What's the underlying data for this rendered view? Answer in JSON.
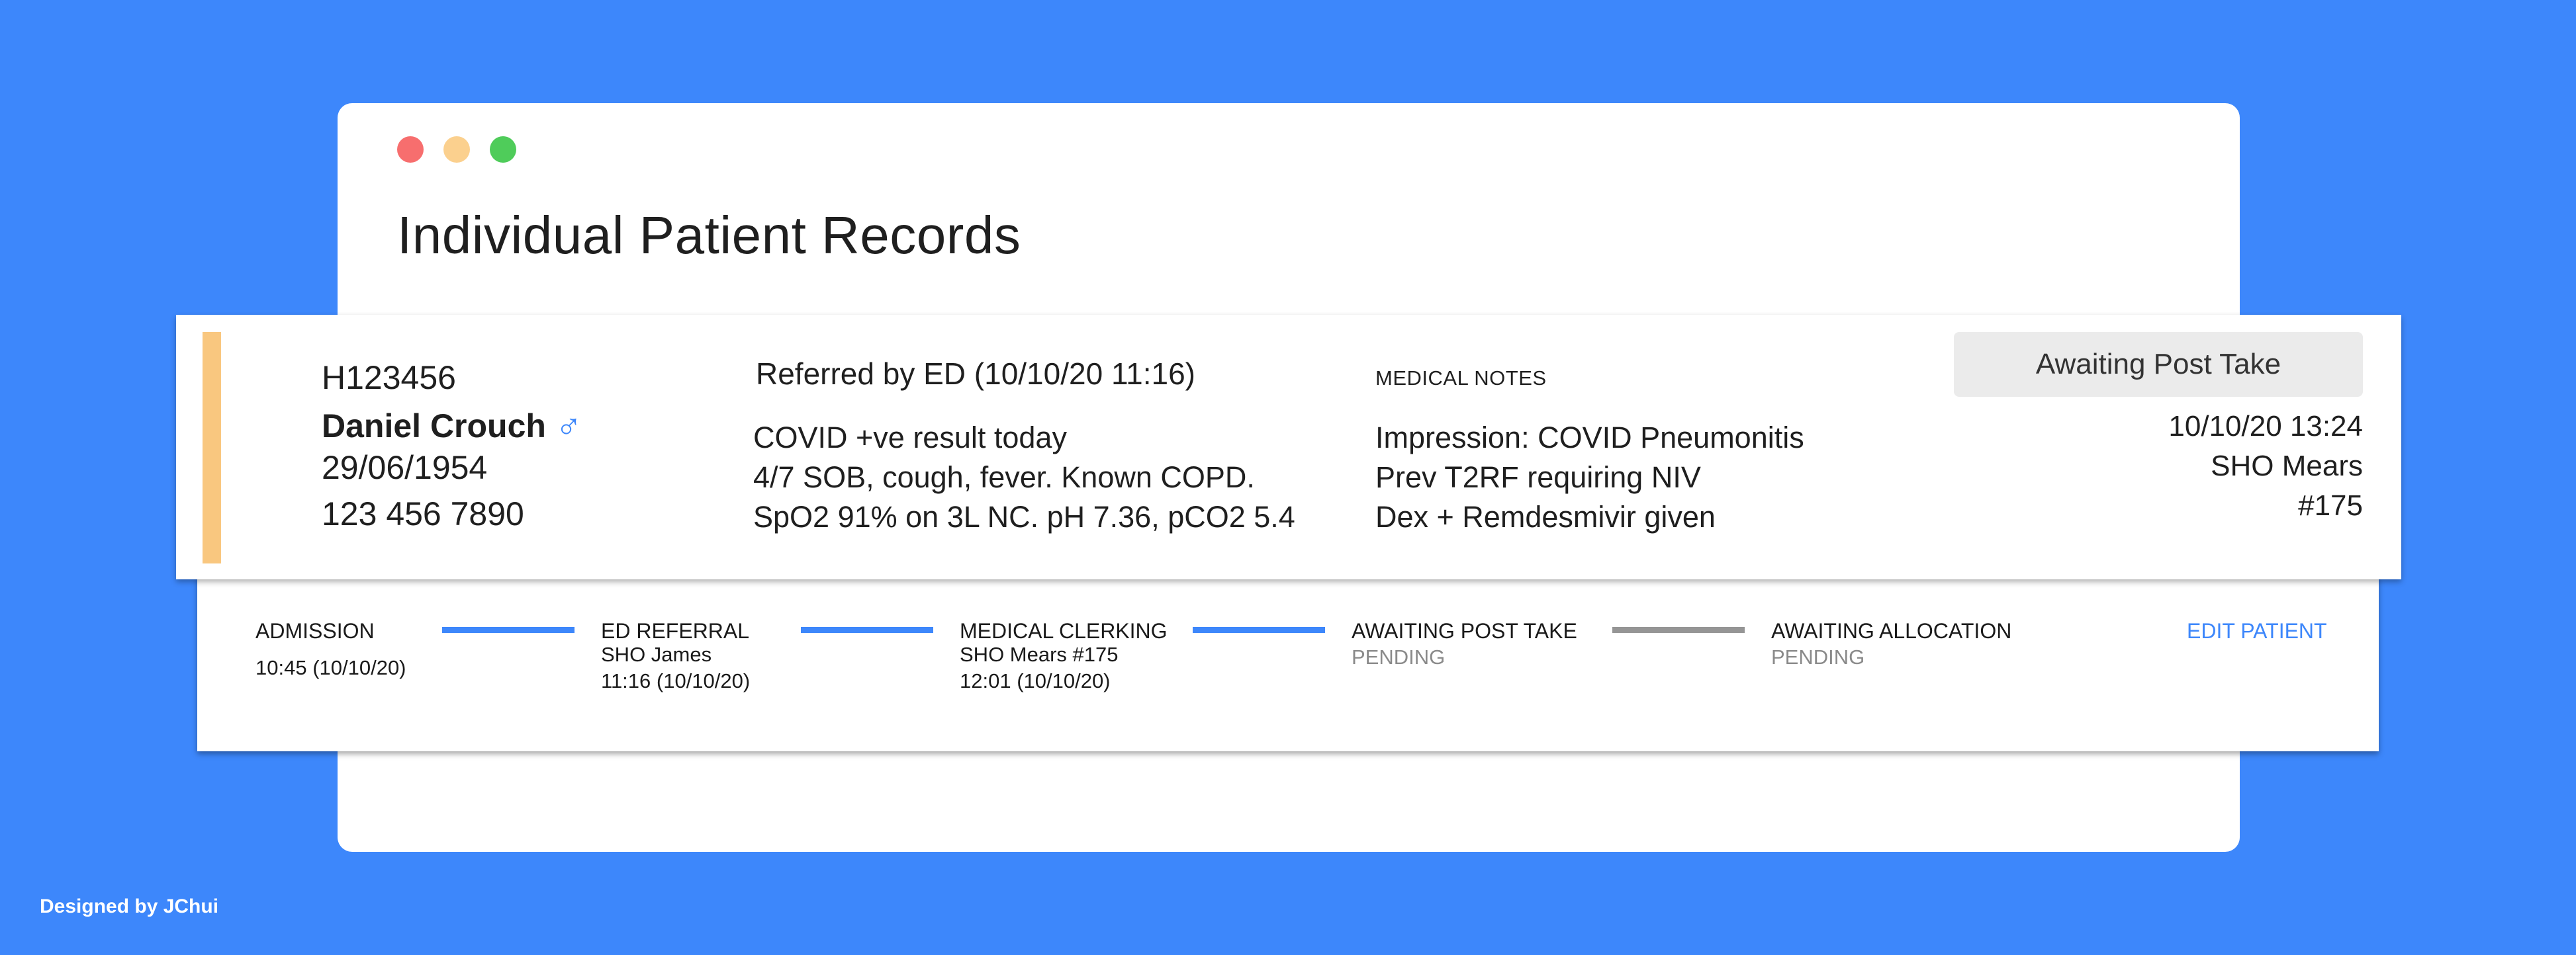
{
  "window": {
    "title": "Individual Patient Records"
  },
  "patient": {
    "hospital_number": "H123456",
    "name": "Daniel Crouch",
    "gender_icon": "male-icon",
    "dob": "29/06/1954",
    "phone": "123 456 7890",
    "accent_color": "#f9c77f"
  },
  "referral": {
    "heading": "Referred by ED (10/10/20 11:16)",
    "lines": [
      "COVID +ve result today",
      "4/7 SOB, cough, fever. Known COPD.",
      "SpO2 91% on 3L NC. pH 7.36, pCO2 5.4"
    ]
  },
  "medical_notes": {
    "label": "MEDICAL NOTES",
    "lines": [
      "Impression: COVID Pneumonitis",
      "Prev T2RF requiring NIV",
      "Dex + Remdesmivir given"
    ]
  },
  "status": {
    "badge": "Awaiting Post Take",
    "datetime": "10/10/20 13:24",
    "doctor": "SHO Mears",
    "number": "#175"
  },
  "timeline": {
    "stages": [
      {
        "title": "ADMISSION",
        "lines": [
          "10:45 (10/10/20)"
        ]
      },
      {
        "title": "ED REFERRAL",
        "lines": [
          "SHO James",
          "11:16 (10/10/20)"
        ]
      },
      {
        "title": "MEDICAL CLERKING",
        "lines": [
          "SHO Mears #175",
          "12:01 (10/10/20)"
        ]
      },
      {
        "title": "AWAITING POST TAKE",
        "lines": [
          "PENDING"
        ]
      },
      {
        "title": "AWAITING ALLOCATION",
        "lines": [
          "PENDING"
        ]
      }
    ],
    "connectors": [
      {
        "status": "complete",
        "color": "#3d87fb"
      },
      {
        "status": "complete",
        "color": "#3d87fb"
      },
      {
        "status": "complete",
        "color": "#3d87fb"
      },
      {
        "status": "pending",
        "color": "#959595"
      }
    ],
    "edit_label": "EDIT PATIENT"
  },
  "footer": {
    "credit": "Designed by JChui"
  },
  "colors": {
    "background": "#3d87fb",
    "accent": "#3d87fb",
    "pending": "#8a8a8a"
  }
}
